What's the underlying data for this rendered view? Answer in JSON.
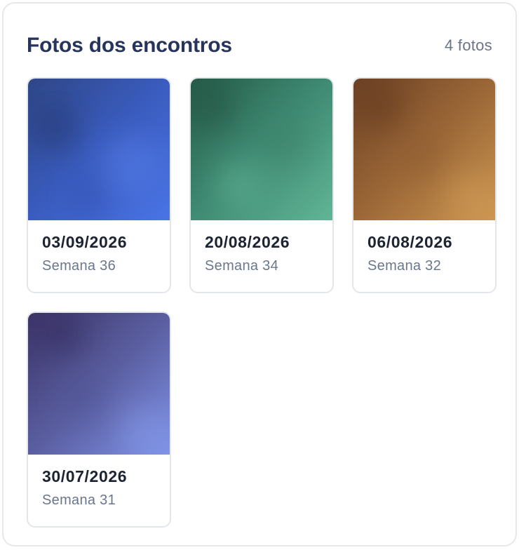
{
  "header": {
    "title": "Fotos dos encontros",
    "count": "4 fotos"
  },
  "photos": [
    {
      "date": "03/09/2026",
      "week": "Semana 36",
      "colors": [
        "#2f4686",
        "#3a5cbf",
        "#4a74e6"
      ]
    },
    {
      "date": "20/08/2026",
      "week": "Semana 34",
      "colors": [
        "#275c4a",
        "#3f8b73",
        "#61b596"
      ]
    },
    {
      "date": "06/08/2026",
      "week": "Semana 32",
      "colors": [
        "#6d4226",
        "#9b6737",
        "#cc9651"
      ]
    },
    {
      "date": "30/07/2026",
      "week": "Semana 31",
      "colors": [
        "#3c3468",
        "#5a5ea0",
        "#7f92e6"
      ]
    }
  ]
}
